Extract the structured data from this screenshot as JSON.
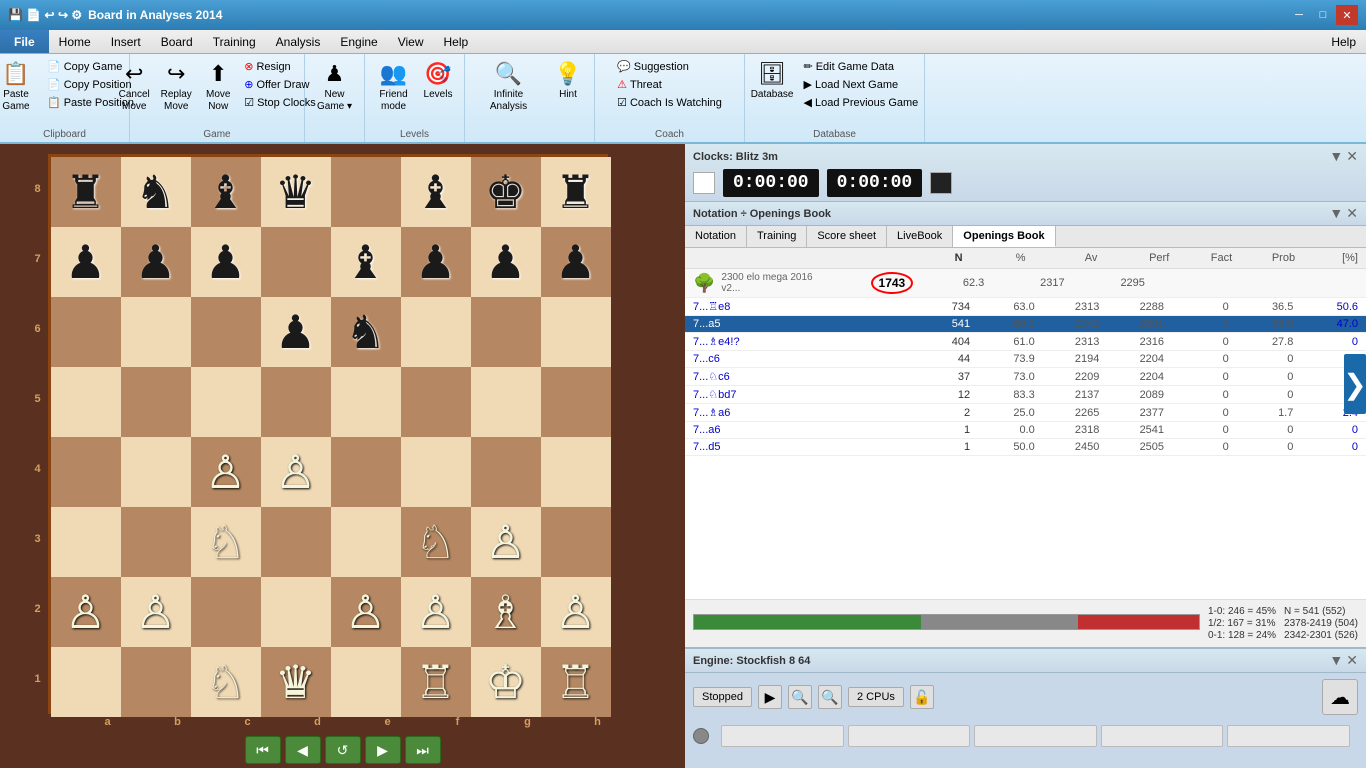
{
  "titlebar": {
    "title": "Board in Analyses 2014",
    "icons": [
      "💾",
      "📄",
      "↩",
      "↪",
      "⚙"
    ],
    "min": "─",
    "max": "□",
    "close": "✕"
  },
  "menubar": {
    "items": [
      "File",
      "Home",
      "Insert",
      "Board",
      "Training",
      "Analysis",
      "Engine",
      "View",
      "Help"
    ],
    "help_right": "Help"
  },
  "ribbon": {
    "clipboard_group": "Clipboard",
    "paste_label": "Paste Game",
    "copy_game_label": "Copy Game",
    "copy_position_label": "Copy Position",
    "paste_position_label": "Paste Position",
    "game_group": "Game",
    "cancel_move_label": "Cancel Move",
    "replay_move_label": "Replay Move",
    "move_now_label": "Move Now",
    "resign_label": "Resign",
    "offer_draw_label": "Offer Draw",
    "stop_clocks_label": "Stop Clocks",
    "new_game_label": "New Game",
    "levels_group": "Levels",
    "friend_mode_label": "Friend mode",
    "levels_label": "Levels",
    "analysis_group": "",
    "infinite_analysis_label": "Infinite Analysis",
    "hint_label": "Hint",
    "suggestion_label": "Suggestion",
    "threat_label": "Threat",
    "coach_watching_label": "Coach Is Watching",
    "coach_group": "Coach",
    "database_label": "Database",
    "database_group": "Database",
    "edit_game_data_label": "Edit Game Data",
    "load_next_game_label": "Load Next Game",
    "load_prev_game_label": "Load Previous Game"
  },
  "clocks": {
    "title": "Clocks: Blitz 3m",
    "time_white": "0:00:00",
    "time_black": "0:00:00"
  },
  "notation": {
    "title": "Notation ÷ Openings Book",
    "tabs": [
      "Notation",
      "Training",
      "Score sheet",
      "LiveBook",
      "Openings Book"
    ]
  },
  "openings": {
    "db_label": "2300 elo mega 2016 v2...",
    "columns": [
      "N",
      "%",
      "Av",
      "Perf",
      "Fact",
      "Prob",
      "[%]"
    ],
    "total_n": "1743",
    "total_pct": "62.3",
    "total_av": "2317",
    "total_perf": "2295",
    "rows": [
      {
        "move": "7...♖e8",
        "n": "734",
        "pct": "63.0",
        "av": "2313",
        "perf": "2288",
        "fact": "0",
        "prob": "36.5",
        "pct2": "50.6"
      },
      {
        "move": "7...a5",
        "n": "541",
        "pct": "60.9",
        "av": "2342",
        "perf": "2301",
        "fact": "0",
        "prob": "33.9",
        "pct2": "47.0",
        "selected": true
      },
      {
        "move": "7...♗e4!?",
        "n": "404",
        "pct": "61.0",
        "av": "2313",
        "perf": "2316",
        "fact": "0",
        "prob": "27.8",
        "pct2": "0"
      },
      {
        "move": "7...c6",
        "n": "44",
        "pct": "73.9",
        "av": "2194",
        "perf": "2204",
        "fact": "0",
        "prob": "0",
        "pct2": "0"
      },
      {
        "move": "7...♘c6",
        "n": "37",
        "pct": "73.0",
        "av": "2209",
        "perf": "2204",
        "fact": "0",
        "prob": "0",
        "pct2": "0"
      },
      {
        "move": "7...♘bd7",
        "n": "12",
        "pct": "83.3",
        "av": "2137",
        "perf": "2089",
        "fact": "0",
        "prob": "0",
        "pct2": "0"
      },
      {
        "move": "7...♗a6",
        "n": "2",
        "pct": "25.0",
        "av": "2265",
        "perf": "2377",
        "fact": "0",
        "prob": "1.7",
        "pct2": "2.4"
      },
      {
        "move": "7...a6",
        "n": "1",
        "pct": "0.0",
        "av": "2318",
        "perf": "2541",
        "fact": "0",
        "prob": "0",
        "pct2": "0"
      },
      {
        "move": "7...d5",
        "n": "1",
        "pct": "50.0",
        "av": "2450",
        "perf": "2505",
        "fact": "0",
        "prob": "0",
        "pct2": "0"
      }
    ]
  },
  "stats": {
    "green_pct": 45,
    "grey_pct": 31,
    "red_pct": 24,
    "label1": "1-0: 246 = 45%",
    "label2": "1/2: 167 = 31%",
    "label3": "0-1: 128 = 24%",
    "n_label": "N = 541 (552)",
    "elo1": "2378-2419 (504)",
    "elo2": "2342-2301 (526)"
  },
  "engine": {
    "title": "Engine: Stockfish 8 64",
    "stopped_label": "Stopped",
    "cpus_label": "2 CPUs"
  },
  "nav": {
    "first": "⏮",
    "prev": "◀",
    "undo": "↺",
    "next": "▶",
    "last": "⏭"
  },
  "board": {
    "files": [
      "a",
      "b",
      "c",
      "d",
      "e",
      "f",
      "g",
      "h"
    ],
    "ranks": [
      "8",
      "7",
      "6",
      "5",
      "4",
      "3",
      "2",
      "1"
    ]
  }
}
